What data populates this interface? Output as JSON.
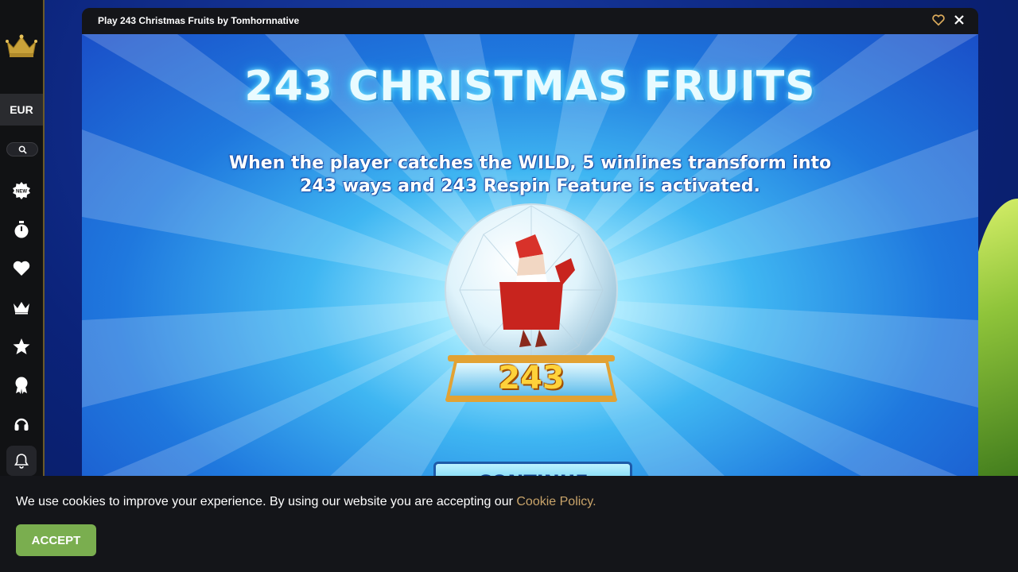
{
  "sidebar": {
    "logo_icon": "crown-logo-icon",
    "currency": "EUR",
    "items": [
      {
        "icon": "new-badge-icon"
      },
      {
        "icon": "stopwatch-icon"
      },
      {
        "icon": "heart-icon"
      },
      {
        "icon": "crown-icon"
      },
      {
        "icon": "star-icon"
      },
      {
        "icon": "award-ribbon-icon"
      },
      {
        "icon": "headset-icon"
      },
      {
        "icon": "bell-icon"
      }
    ]
  },
  "modal": {
    "title": "Play 243 Christmas Fruits by Tomhornnative",
    "favorite_icon": "heart-outline-icon",
    "close_icon": "close-icon"
  },
  "game": {
    "title": "243 CHRISTMAS FRUITS",
    "description_line1": "When the player catches the WILD, 5 winlines transform into",
    "description_line2": "243 ways and 243 Respin Feature is activated.",
    "globe_number": "243",
    "continue_label": "CONTINUE"
  },
  "cookie": {
    "text": "We use cookies to improve your experience. By using our website you are accepting our ",
    "link": "Cookie Policy.",
    "accept": "ACCEPT"
  },
  "colors": {
    "accent_gold": "#c9a46a",
    "accept_green": "#7aae4f",
    "sidebar_bg": "#111214"
  }
}
